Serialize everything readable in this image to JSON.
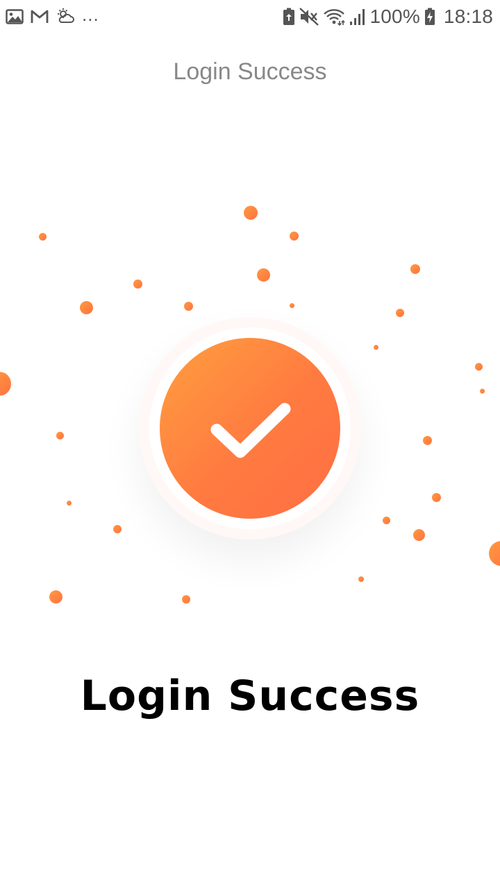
{
  "status_bar": {
    "left_icons": [
      "image-icon",
      "gmail-icon",
      "weather-icon"
    ],
    "more": "...",
    "right_icons": [
      "battery-saver-icon",
      "mute-icon",
      "wifi-icon",
      "signal-icon",
      "battery-icon"
    ],
    "battery_percent": "100%",
    "time": "18:18"
  },
  "header": {
    "title": "Login Success"
  },
  "success": {
    "icon": "check-icon",
    "accent_start": "#ff9f3f",
    "accent_end": "#ff6f44",
    "message": "Login Success"
  }
}
